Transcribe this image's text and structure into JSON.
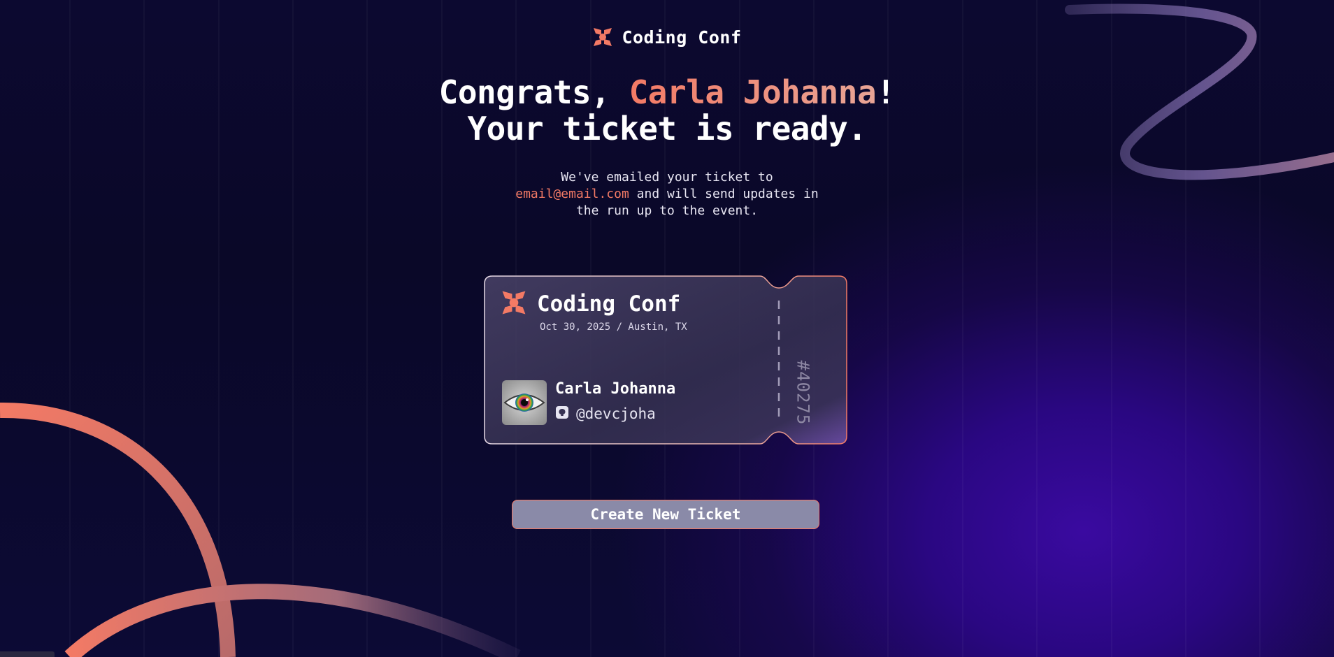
{
  "brand": {
    "name": "Coding Conf",
    "logo_icon": "coding-conf-logo-icon",
    "accent": "#f37a65"
  },
  "headline": {
    "greeting": "Congrats, ",
    "name": "Carla Johanna",
    "exclaim": "!",
    "line2": "Your ticket is ready."
  },
  "message": {
    "pre": "We've emailed your ticket to",
    "email": "email@email.com",
    "post1": " and will send updates in",
    "post2": "the run up to the event."
  },
  "ticket": {
    "event": "Coding Conf",
    "date_location": "Oct 30, 2025 / Austin, TX",
    "attendee_name": "Carla Johanna",
    "github_icon": "github-icon",
    "github_handle": "@devcjoha",
    "number": "#40275"
  },
  "actions": {
    "create_label": "Create New Ticket"
  }
}
